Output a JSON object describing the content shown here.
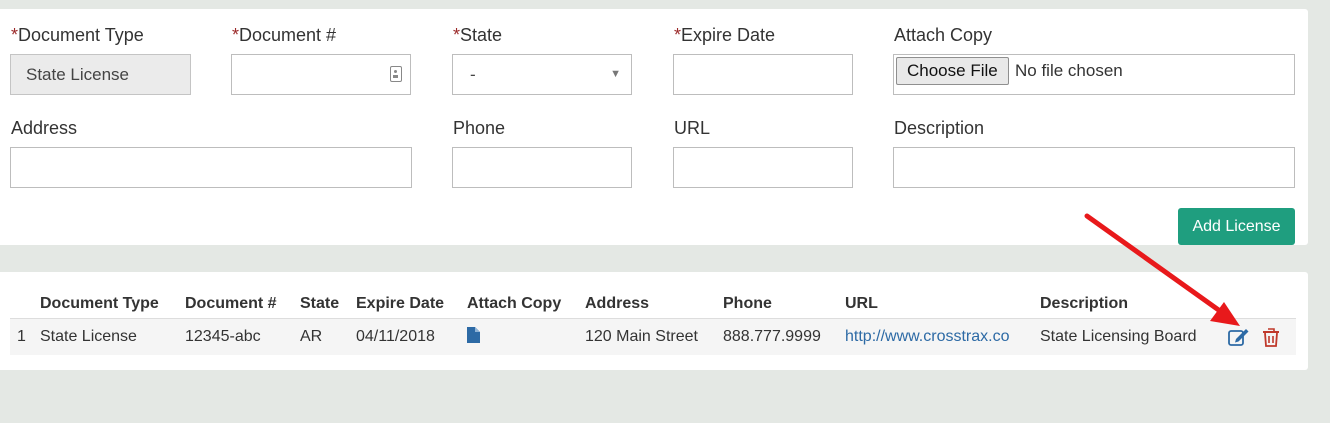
{
  "form": {
    "required_mark": "*",
    "document_type_label": "Document Type",
    "document_type_value": "State License",
    "document_number_label": "Document #",
    "document_number_value": "",
    "state_label": "State",
    "state_value": "-",
    "expire_date_label": "Expire Date",
    "expire_date_value": "",
    "attach_copy_label": "Attach Copy",
    "choose_file_label": "Choose File",
    "no_file_text": "No file chosen",
    "address_label": "Address",
    "phone_label": "Phone",
    "url_label": "URL",
    "description_label": "Description",
    "add_button_label": "Add License"
  },
  "table": {
    "headers": [
      "Document Type",
      "Document #",
      "State",
      "Expire Date",
      "Attach Copy",
      "Address",
      "Phone",
      "URL",
      "Description"
    ],
    "rows": [
      {
        "index": "1",
        "document_type": "State License",
        "document_number": "12345-abc",
        "state": "AR",
        "expire_date": "04/11/2018",
        "address": "120 Main Street",
        "phone": "888.777.9999",
        "url": "http://www.crosstrax.co",
        "description": "State Licensing Board"
      }
    ]
  },
  "colors": {
    "accent": "#1f9e7f",
    "required": "#9b2a2a",
    "link": "#2d6aa5",
    "delete": "#c0392b",
    "annotation_arrow": "#e8191b"
  },
  "icons": {
    "attach": "document-icon",
    "edit": "edit-icon",
    "delete": "trash-icon",
    "contact": "contact-card-icon",
    "select": "chevron-down-icon"
  }
}
